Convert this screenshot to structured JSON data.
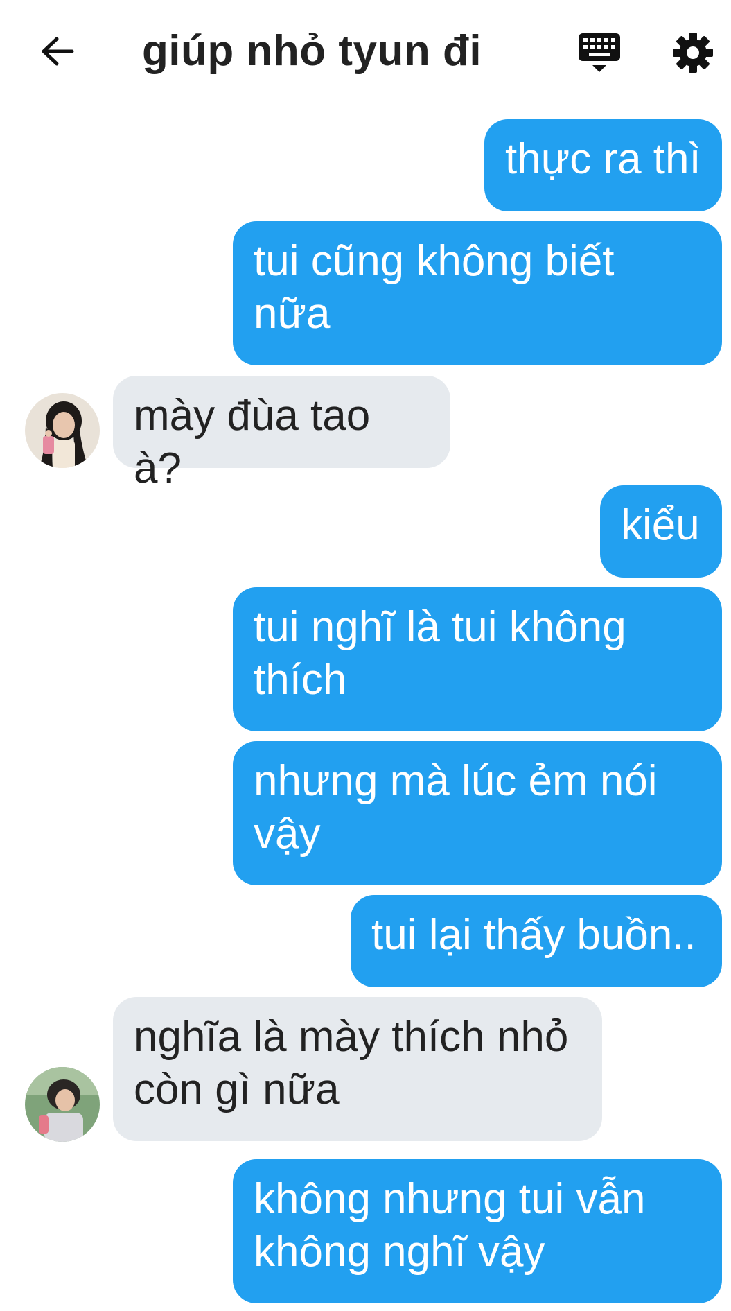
{
  "header": {
    "title": "giúp nhỏ tyun đi",
    "back_icon": "arrow-left-icon",
    "keyboard_icon": "keyboard-icon",
    "settings_icon": "gear-icon"
  },
  "colors": {
    "outgoing_bubble": "#22a0f0",
    "incoming_bubble": "#e6eaee",
    "text_dark": "#222222"
  },
  "messages": [
    {
      "side": "out",
      "text": "thực ra thì"
    },
    {
      "side": "out",
      "text": "tui cũng không biết nữa"
    },
    {
      "side": "in",
      "text": "mày đùa tao à?"
    },
    {
      "side": "out",
      "text": "kiểu"
    },
    {
      "side": "out",
      "text": "tui nghĩ là tui không thích"
    },
    {
      "side": "out",
      "text": "nhưng mà lúc ẻm nói vậy"
    },
    {
      "side": "out",
      "text": "tui lại thấy buồn.."
    },
    {
      "side": "in",
      "text": "nghĩa là mày thích nhỏ còn gì nữa"
    },
    {
      "side": "out",
      "text": "không nhưng tui vẫn không nghĩ vậy"
    }
  ]
}
